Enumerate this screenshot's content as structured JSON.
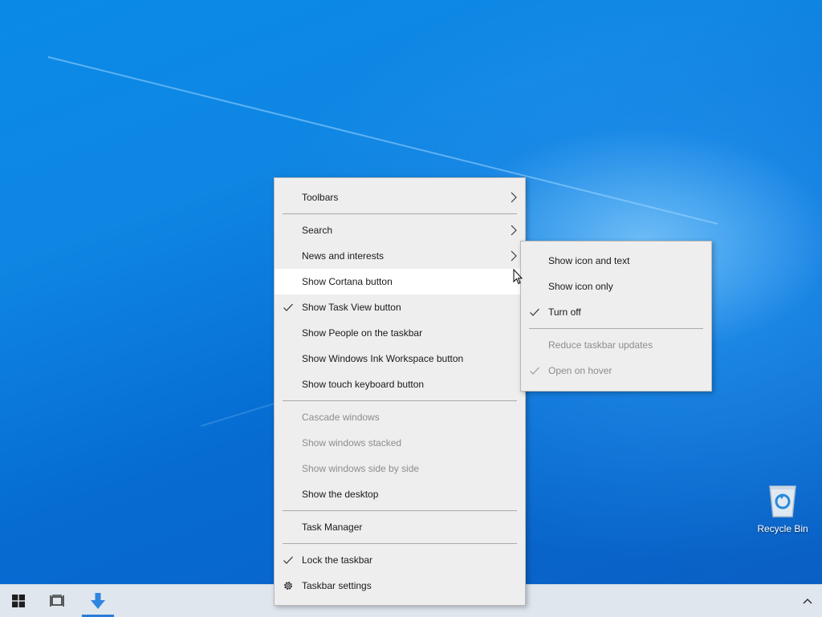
{
  "desktop": {
    "recycle_bin_label": "Recycle Bin"
  },
  "taskbar": {
    "start_icon": "windows-logo-icon",
    "task_view_icon": "task-view-icon",
    "app_icon": "download-arrow-icon",
    "tray_chevron_icon": "chevron-up-icon"
  },
  "context_menu": {
    "toolbars": "Toolbars",
    "search": "Search",
    "news_and_interests": "News and interests",
    "show_cortana": "Show Cortana button",
    "show_task_view": "Show Task View button",
    "show_people": "Show People on the taskbar",
    "show_ink_workspace": "Show Windows Ink Workspace button",
    "show_touch_keyboard": "Show touch keyboard button",
    "cascade_windows": "Cascade windows",
    "show_windows_stacked": "Show windows stacked",
    "show_side_by_side": "Show windows side by side",
    "show_desktop": "Show the desktop",
    "task_manager": "Task Manager",
    "lock_taskbar": "Lock the taskbar",
    "taskbar_settings": "Taskbar settings"
  },
  "news_submenu": {
    "show_icon_and_text": "Show icon and text",
    "show_icon_only": "Show icon only",
    "turn_off": "Turn off",
    "reduce_updates": "Reduce taskbar updates",
    "open_on_hover": "Open on hover"
  },
  "colors": {
    "desktop_blue": "#0a74d8",
    "taskbar": "#dfe6ee",
    "menu_bg": "#eeeeee",
    "menu_hover": "#ffffff",
    "disabled_text": "#8d8d8d",
    "accent": "#2b7bd8"
  }
}
